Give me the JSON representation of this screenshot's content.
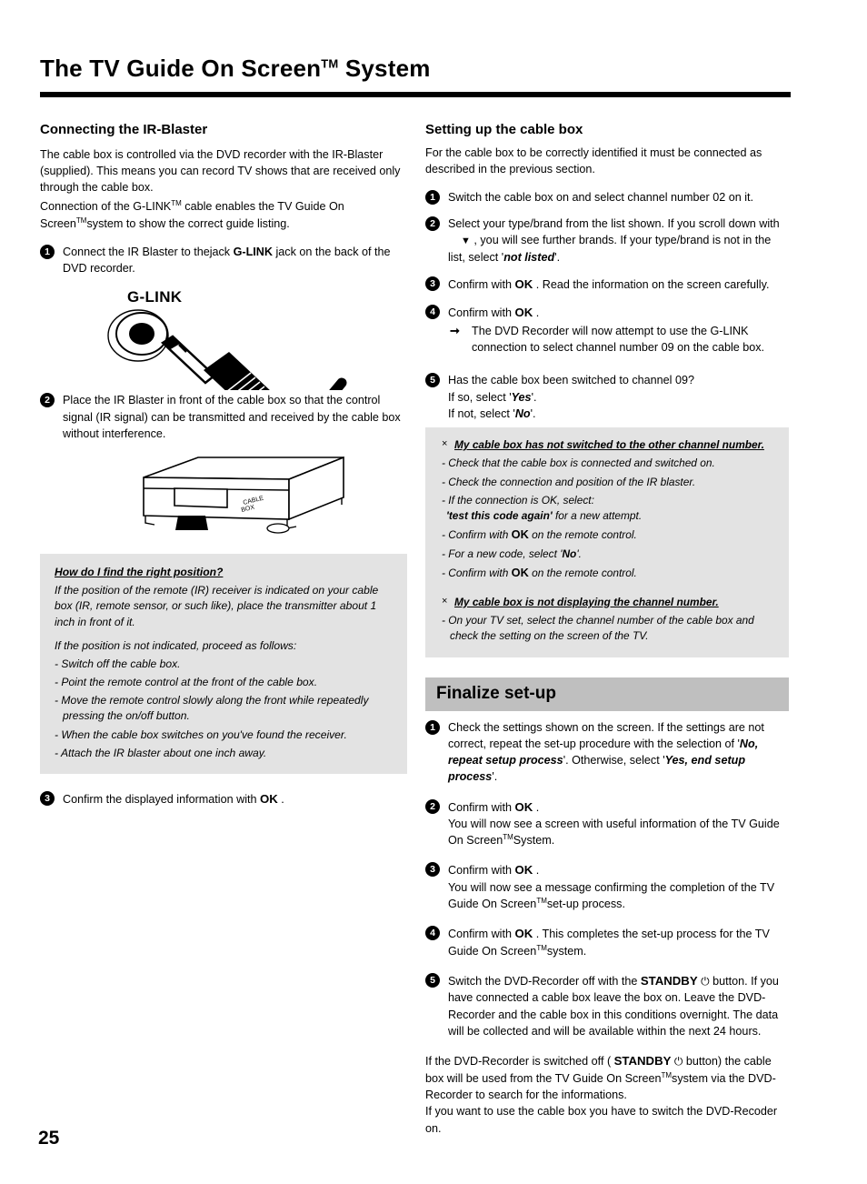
{
  "header": {
    "title_main": "The TV Guide On Screen",
    "title_tm": "TM",
    "title_tail": "System"
  },
  "page_number": "25",
  "left_column": {
    "section_title": "Connecting the IR-Blaster",
    "intro_p1": "The cable box is controlled via the DVD recorder with the IR-Blaster (supplied). This means you can record TV shows that are received only through the cable box.",
    "intro_p2a": "Connection of the G-LINK",
    "intro_p2b": " cable enables the TV Guide On Screen",
    "intro_p2c": "system to show the correct guide listing.",
    "step1_num": "1",
    "step1_a": "Connect the IR Blaster to thejack ",
    "step1_key": "G-LINK",
    "step1_b": " jack on the back of the DVD recorder.",
    "glink_label": "G-LINK",
    "step2_num": "2",
    "step2_text": "Place the IR Blaster in front of the cable box so that the control signal (IR signal) can be transmitted and received by the cable box without interference.",
    "cablebox_label_line1": "CABLE",
    "cablebox_label_line2": "BOX",
    "greybox": {
      "title": "How do I find the right position?",
      "p1": "If the position of the remote (IR) receiver is indicated on your cable box (IR, remote sensor, or such like), place the transmitter about 1 inch in front of it.",
      "p2": "If the position is not indicated, proceed as follows:",
      "bullets": [
        "- Switch off the cable box.",
        "- Point the remote control at the front of the cable box.",
        "- Move the remote control slowly along the front while repeatedly pressing the on/off button.",
        "- When the cable box switches on you've found the receiver.",
        "- Attach the IR blaster about one inch away."
      ]
    },
    "step3_num": "3",
    "step3_a": "Confirm the displayed information with ",
    "step3_ok": "OK",
    "step3_b": " ."
  },
  "right_column": {
    "section_title": "Setting up the cable box",
    "intro": "For the cable box to be correctly identified it must be connected as described in the previous section.",
    "step1_num": "1",
    "step1_text": "Switch the cable box on and select channel number 02 on it.",
    "step2_num": "2",
    "step2_a": "Select your type/brand from the list shown. If you scroll down with",
    "step2_arrow": "▼",
    "step2_b": ", you will see further brands. If your type/brand is not in the list, select '",
    "step2_em": "not listed",
    "step2_c": "'.",
    "step3_num": "3",
    "step3_a": "Confirm with ",
    "step3_ok": "OK",
    "step3_b": " . Read the information on the screen carefully.",
    "step4_num": "4",
    "step4_a": "Confirm with ",
    "step4_ok": "OK",
    "step4_b": " .",
    "step4_sub": "The DVD Recorder will now attempt to use the G-LINK connection to select channel number 09 on the cable box.",
    "step5_num": "5",
    "step5_l1": "Has the cable box been switched to channel 09?",
    "step5_l2a": "If so, select '",
    "step5_l2em": "Yes",
    "step5_l2b": "'.",
    "step5_l3a": "If not, select '",
    "step5_l3em": "No",
    "step5_l3b": "'.",
    "greybox": {
      "head1_x": "×",
      "head1": "My cable box has not switched to the other channel number.",
      "b1": "- Check that the cable box is connected and switched on.",
      "b2": "- Check the connection and position of the IR blaster.",
      "b3": "- If the connection is OK, select:",
      "b3b_em": "'test this code again'",
      "b3b_rest": " for a new attempt.",
      "b4a": "- Confirm with ",
      "b4ok": "OK",
      "b4b": " on the remote control.",
      "b5a": "- For a new code, select '",
      "b5em": "No",
      "b5b": "'.",
      "b6a": "- Confirm with ",
      "b6ok": "OK",
      "b6b": " on the remote control.",
      "head2_x": "×",
      "head2": "My cable box is not displaying the channel number.",
      "b7": "- On your TV set, select the channel number of the cable box and check the setting on the screen of the TV."
    },
    "finalize_banner": "Finalize set-up",
    "f1_num": "1",
    "f1_a": "Check the settings shown on the screen. If the settings are not correct, repeat the set-up procedure with the selection of '",
    "f1_em1": "No, repeat setup process",
    "f1_b": "'. Otherwise, select '",
    "f1_em2": "Yes, end setup process",
    "f1_c": "'.",
    "f2_num": "2",
    "f2_a": "Confirm with ",
    "f2_ok": "OK",
    "f2_b": " .",
    "f2_l2": "You will now see a screen with useful information of the TV Guide On Screen",
    "f2_l3": "System.",
    "f3_num": "3",
    "f3_a": "Confirm with ",
    "f3_ok": "OK",
    "f3_b": " .",
    "f3_l2": "You will now see a message confirming the completion of the TV Guide On Screen",
    "f3_l3": "set-up process.",
    "f4_num": "4",
    "f4_a": "Confirm with ",
    "f4_ok": "OK",
    "f4_b": " . This completes the set-up process for the TV Guide On Screen",
    "f4_c": "system.",
    "f5_num": "5",
    "f5_a": "Switch the DVD-Recorder off with the ",
    "f5_standby": "STANDBY",
    "f5_power": "⏻",
    "f5_b": " button. If you have connected a cable box leave the box on. Leave the DVD-Recorder and the cable box in this conditions overnight. The data will be collected and will be available within the next 24 hours.",
    "footnote_a": "If the DVD-Recorder is switched off ( ",
    "footnote_standby": "STANDBY",
    "footnote_power": "⏻",
    "footnote_b": " button) the cable box will be used from the TV Guide On Screen",
    "footnote_c": "system via the DVD-Recorder to search for the informations.",
    "footnote_d": "If you want to use the cable box you have to switch the DVD-Recoder on."
  },
  "colors": {
    "grey_box": "#e3e3e3",
    "banner_grey": "#bfbfbf",
    "rule_black": "#000000"
  }
}
